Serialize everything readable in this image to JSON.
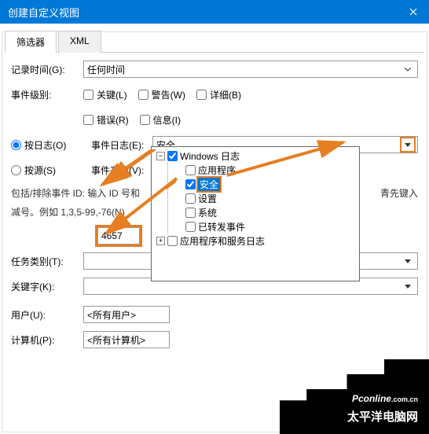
{
  "titlebar": {
    "title": "创建自定义视图"
  },
  "tabs": {
    "filter": "筛选器",
    "xml": "XML"
  },
  "labels": {
    "log_time": "记录时间(G):",
    "event_level": "事件级别:",
    "by_log": "按日志(O)",
    "by_source": "按源(S)",
    "event_log": "事件日志(E):",
    "event_source": "事件来源(V):",
    "id_help": "包括/排除事件 ID: 输入 ID 号和",
    "id_help2": "减号。例如 1,3,5-99,-76(N)",
    "id_help_tail": "青先键入",
    "task_category": "任务类别(T):",
    "keywords": "关键字(K):",
    "user": "用户(U):",
    "computer": "计算机(P):"
  },
  "values": {
    "log_time_value": "任何时间",
    "event_log_value": "安全",
    "id_value": "4657",
    "user_value": "<所有用户>",
    "computer_value": "<所有计算机>"
  },
  "checks": {
    "critical": "关键(L)",
    "warning": "警告(W)",
    "verbose": "详细(B)",
    "error": "错误(R)",
    "information": "信息(I)"
  },
  "tree": {
    "root": "Windows 日志",
    "app": "应用程序",
    "security": "安全",
    "setup": "设置",
    "system": "系统",
    "forwarded": "已转发事件",
    "appservices": "应用程序和服务日志"
  },
  "watermark": {
    "line1a": "Pc",
    "line1b": "online",
    "line1c": ".com.cn",
    "line2": "太平洋电脑网"
  }
}
